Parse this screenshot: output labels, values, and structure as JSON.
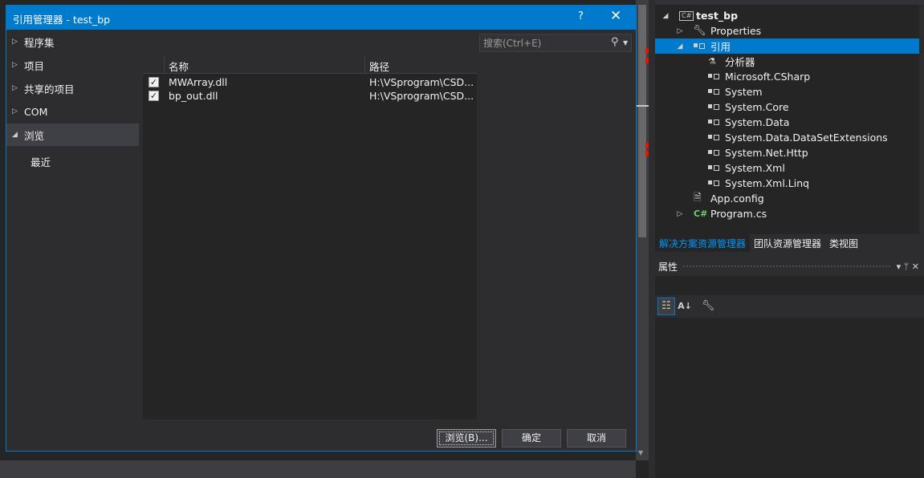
{
  "dialog": {
    "title": "引用管理器 - test_bp",
    "help_label": "?",
    "close_label": "✕",
    "search_placeholder": "搜索(Ctrl+E)",
    "nav": [
      {
        "label": "程序集",
        "expanded": false
      },
      {
        "label": "项目",
        "expanded": false
      },
      {
        "label": "共享的项目",
        "expanded": false
      },
      {
        "label": "COM",
        "expanded": false
      },
      {
        "label": "浏览",
        "expanded": true
      }
    ],
    "nav_sub": "最近",
    "columns": {
      "name": "名称",
      "path": "路径"
    },
    "rows": [
      {
        "checked": true,
        "name": "MWArray.dll",
        "path": "H:\\VSprogram\\CSD..."
      },
      {
        "checked": true,
        "name": "bp_out.dll",
        "path": "H:\\VSprogram\\CSD..."
      }
    ],
    "buttons": {
      "browse": "浏览(B)...",
      "ok": "确定",
      "cancel": "取消"
    }
  },
  "solution_explorer": {
    "items": [
      {
        "label": "test_bp",
        "icon": "csharp-project-icon",
        "expander": "◢"
      },
      {
        "label": "Properties",
        "icon": "wrench-icon",
        "expander": "▷"
      },
      {
        "label": "引用",
        "icon": "reference-icon",
        "expander": "◢",
        "selected": true
      },
      {
        "label": "分析器",
        "icon": "analyzer-icon"
      },
      {
        "label": "Microsoft.CSharp",
        "icon": "reference-icon"
      },
      {
        "label": "System",
        "icon": "reference-icon"
      },
      {
        "label": "System.Core",
        "icon": "reference-icon"
      },
      {
        "label": "System.Data",
        "icon": "reference-icon"
      },
      {
        "label": "System.Data.DataSetExtensions",
        "icon": "reference-icon"
      },
      {
        "label": "System.Net.Http",
        "icon": "reference-icon"
      },
      {
        "label": "System.Xml",
        "icon": "reference-icon"
      },
      {
        "label": "System.Xml.Linq",
        "icon": "reference-icon"
      },
      {
        "label": "App.config",
        "icon": "config-file-icon"
      },
      {
        "label": "Program.cs",
        "icon": "csharp-file-icon",
        "expander": "▷"
      }
    ],
    "tabs": [
      "解决方案资源管理器",
      "团队资源管理器",
      "类视图"
    ]
  },
  "properties": {
    "title": "属性",
    "pin_label": "▾ ᛘ ✕"
  },
  "colors": {
    "accent": "#007acc",
    "background": "#2d2d30",
    "panel": "#252526"
  }
}
